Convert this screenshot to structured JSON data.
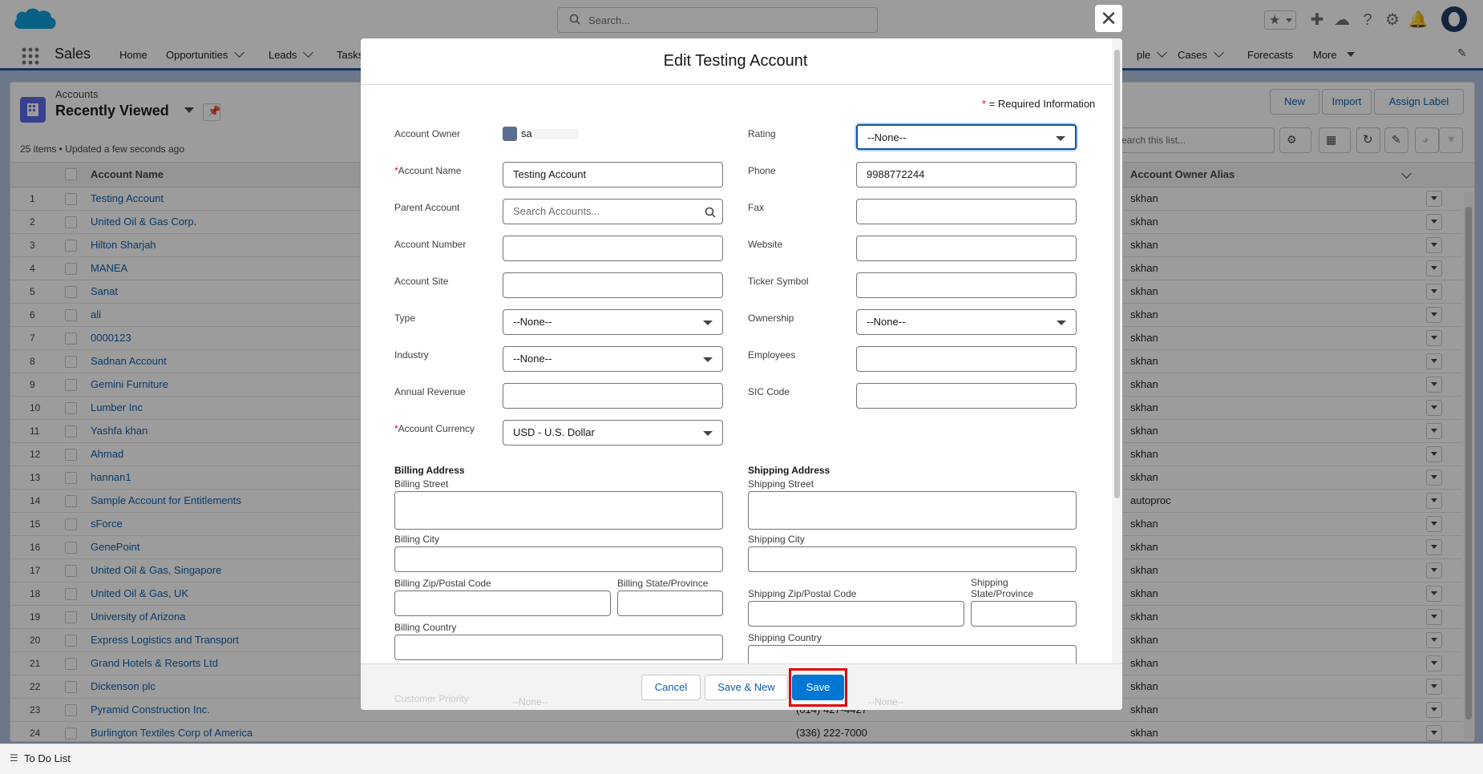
{
  "header": {
    "search_placeholder": "Search...",
    "app_name": "Sales",
    "nav_items": [
      {
        "label": "Home"
      },
      {
        "label": "Opportunities"
      },
      {
        "label": "Leads"
      },
      {
        "label": "Tasks"
      },
      {
        "label": "ple"
      },
      {
        "label": "Cases"
      },
      {
        "label": "Forecasts"
      },
      {
        "label": "More"
      }
    ]
  },
  "list_view": {
    "breadcrumb": "Accounts",
    "title": "Recently Viewed",
    "meta": "25 items • Updated a few seconds ago",
    "buttons": {
      "new": "New",
      "import": "Import",
      "assign_label": "Assign Label"
    },
    "search_placeholder": "Search this list...",
    "columns": {
      "name": "Account Name",
      "alias": "Account Owner Alias"
    },
    "rows": [
      {
        "num": "1",
        "name": "Testing Account",
        "alias": "skhan"
      },
      {
        "num": "2",
        "name": "United Oil & Gas Corp.",
        "alias": "skhan"
      },
      {
        "num": "3",
        "name": "Hilton Sharjah",
        "alias": "skhan"
      },
      {
        "num": "4",
        "name": "MANEA",
        "alias": "skhan"
      },
      {
        "num": "5",
        "name": "Sanat",
        "alias": "skhan"
      },
      {
        "num": "6",
        "name": "ali",
        "alias": "skhan"
      },
      {
        "num": "7",
        "name": "0000123",
        "alias": "skhan"
      },
      {
        "num": "8",
        "name": "Sadnan Account",
        "alias": "skhan"
      },
      {
        "num": "9",
        "name": "Gemini Furniture",
        "alias": "skhan"
      },
      {
        "num": "10",
        "name": "Lumber Inc",
        "alias": "skhan"
      },
      {
        "num": "11",
        "name": "Yashfa khan",
        "alias": "skhan"
      },
      {
        "num": "12",
        "name": "Ahmad",
        "alias": "skhan"
      },
      {
        "num": "13",
        "name": "hannan1",
        "alias": "skhan"
      },
      {
        "num": "14",
        "name": "Sample Account for Entitlements",
        "alias": "autoproc"
      },
      {
        "num": "15",
        "name": "sForce",
        "alias": "skhan"
      },
      {
        "num": "16",
        "name": "GenePoint",
        "alias": "skhan"
      },
      {
        "num": "17",
        "name": "United Oil & Gas, Singapore",
        "alias": "skhan"
      },
      {
        "num": "18",
        "name": "United Oil & Gas, UK",
        "alias": "skhan"
      },
      {
        "num": "19",
        "name": "University of Arizona",
        "alias": "skhan"
      },
      {
        "num": "20",
        "name": "Express Logistics and Transport",
        "alias": "skhan"
      },
      {
        "num": "21",
        "name": "Grand Hotels & Resorts Ltd",
        "alias": "skhan"
      },
      {
        "num": "22",
        "name": "Dickenson plc",
        "alias": "skhan"
      },
      {
        "num": "23",
        "name": "Pyramid Construction Inc.",
        "alias": "skhan",
        "phone": "(014) 427-4427"
      },
      {
        "num": "24",
        "name": "Burlington Textiles Corp of America",
        "alias": "skhan",
        "phone": "(336) 222-7000"
      }
    ]
  },
  "footer": {
    "todo": "To Do List"
  },
  "modal": {
    "title": "Edit Testing Account",
    "required_info": "= Required Information",
    "owner_label": "Account Owner",
    "owner_value": "sa",
    "rating_label": "Rating",
    "rating_value": "--None--",
    "account_name_label": "Account Name",
    "account_name_value": "Testing Account",
    "phone_label": "Phone",
    "phone_value": "9988772244",
    "parent_label": "Parent Account",
    "parent_placeholder": "Search Accounts...",
    "fax_label": "Fax",
    "acct_number_label": "Account Number",
    "website_label": "Website",
    "acct_site_label": "Account Site",
    "ticker_label": "Ticker Symbol",
    "type_label": "Type",
    "type_value": "--None--",
    "ownership_label": "Ownership",
    "ownership_value": "--None--",
    "industry_label": "Industry",
    "industry_value": "--None--",
    "employees_label": "Employees",
    "revenue_label": "Annual Revenue",
    "sic_label": "SIC Code",
    "currency_label": "Account Currency",
    "currency_value": "USD - U.S. Dollar",
    "billing_section": "Billing Address",
    "shipping_section": "Shipping Address",
    "billing_street": "Billing Street",
    "shipping_street": "Shipping Street",
    "billing_city": "Billing City",
    "shipping_city": "Shipping City",
    "billing_zip": "Billing Zip/Postal Code",
    "billing_state": "Billing State/Province",
    "shipping_zip": "Shipping Zip/Postal Code",
    "shipping_state_1": "Shipping",
    "shipping_state_2": "State/Province",
    "billing_country": "Billing Country",
    "shipping_country": "Shipping Country",
    "customer_priority": "Customer Priority",
    "hidden_select_1": "--None--",
    "hidden_select_2": "--None--",
    "cancel": "Cancel",
    "save_new": "Save & New",
    "save": "Save"
  }
}
